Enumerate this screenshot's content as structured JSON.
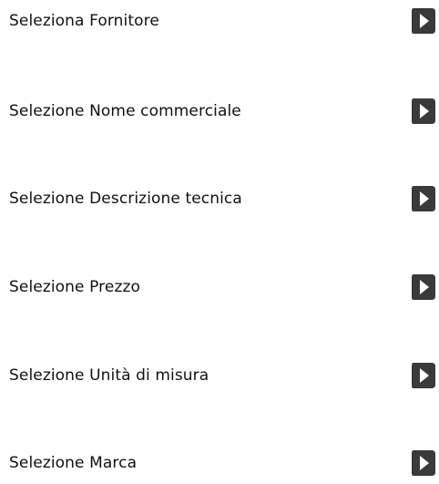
{
  "menu": {
    "items": [
      {
        "label": "Seleziona Fornitore",
        "icon": "play-arrow-icon"
      },
      {
        "label": "Selezione Nome commerciale",
        "icon": "play-arrow-icon"
      },
      {
        "label": "Selezione Descrizione tecnica",
        "icon": "play-arrow-icon"
      },
      {
        "label": "Selezione Prezzo",
        "icon": "play-arrow-icon"
      },
      {
        "label": "Selezione Unità di misura",
        "icon": "play-arrow-icon"
      },
      {
        "label": "Selezione Marca",
        "icon": "play-arrow-icon"
      }
    ]
  },
  "colors": {
    "text": "#111111",
    "icon_fill": "#3a3a3a",
    "icon_arrow": "#ffffff"
  }
}
